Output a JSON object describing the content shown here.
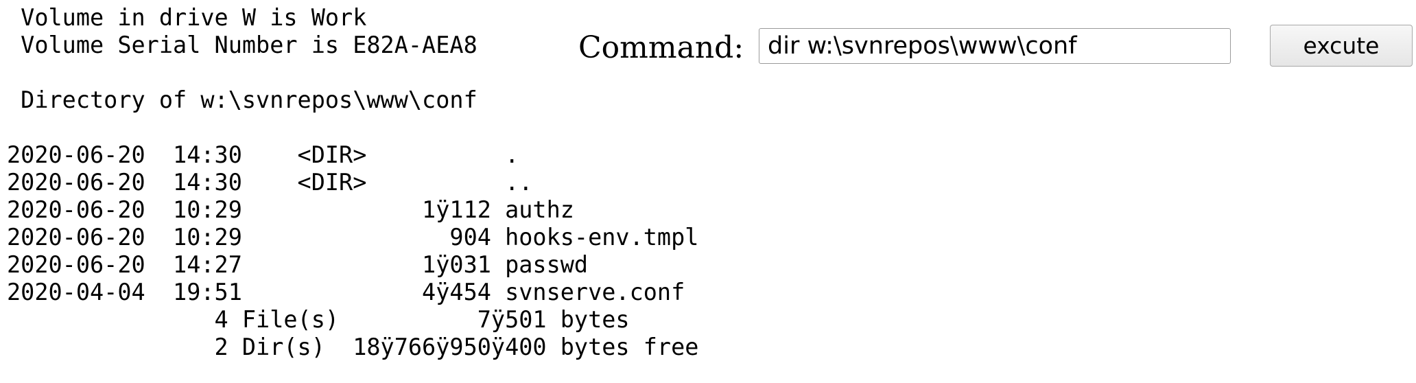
{
  "output": {
    "lines": [
      " Volume in drive W is Work",
      " Volume Serial Number is E82A-AEA8",
      "",
      " Directory of w:\\svnrepos\\www\\conf",
      "",
      "2020-06-20  14:30    <DIR>          .",
      "2020-06-20  14:30    <DIR>          ..",
      "2020-06-20  10:29             1ÿ112 authz",
      "2020-06-20  10:29               904 hooks-env.tmpl",
      "2020-06-20  14:27             1ÿ031 passwd",
      "2020-04-04  19:51             4ÿ454 svnserve.conf",
      "               4 File(s)          7ÿ501 bytes",
      "               2 Dir(s)  18ÿ766ÿ950ÿ400 bytes free"
    ]
  },
  "command": {
    "label": "Command:",
    "value": "dir w:\\svnrepos\\www\\conf"
  },
  "execute_button": {
    "label": "excute"
  }
}
